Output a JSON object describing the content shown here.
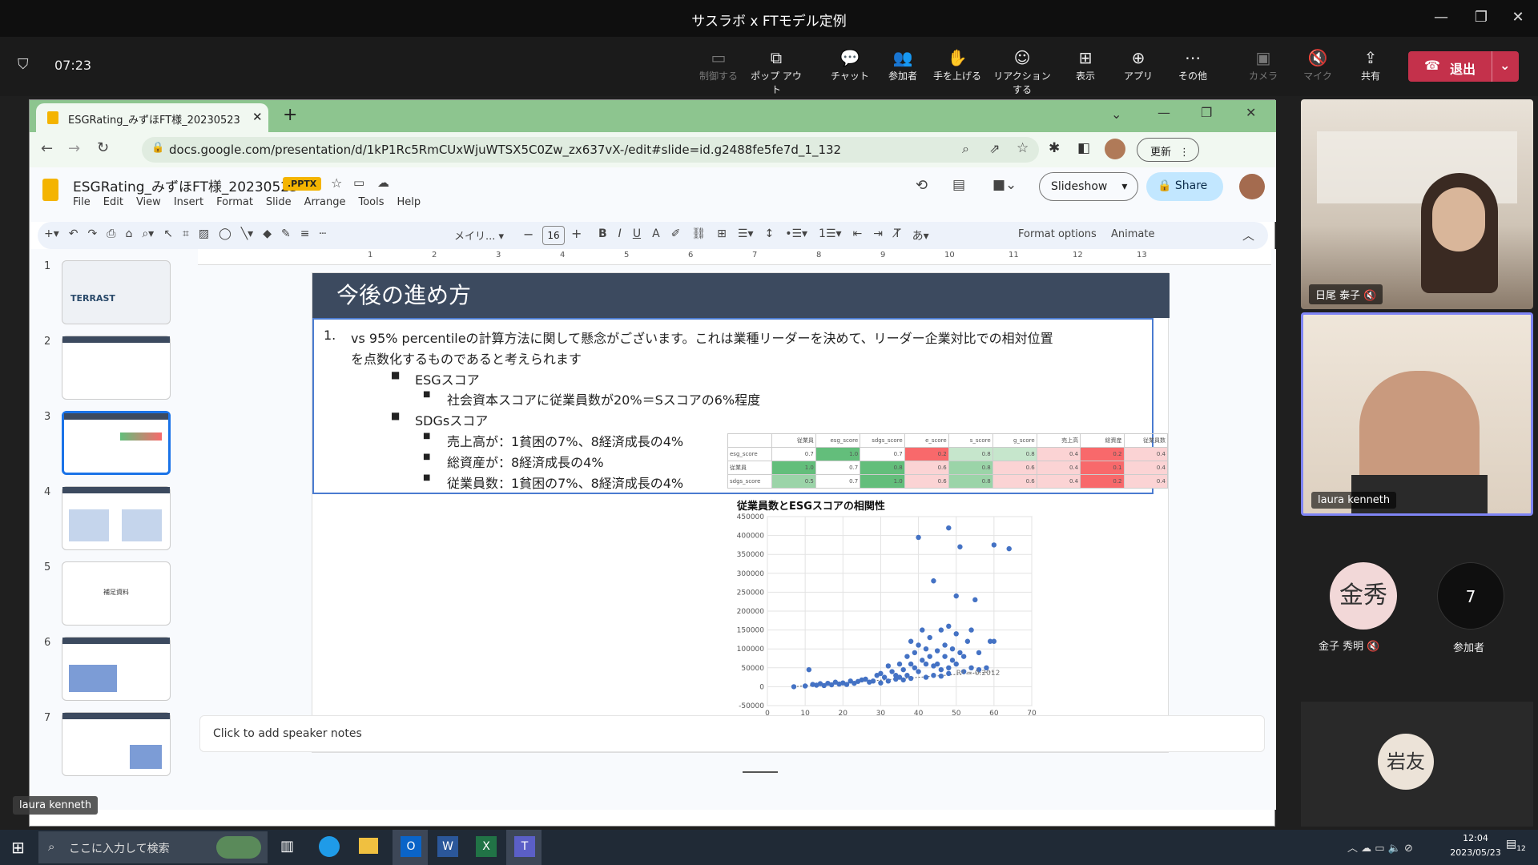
{
  "teams": {
    "window_title": "サスラボ x FTモデル定例",
    "meeting_time": "07:23",
    "buttons": {
      "control": "制御する",
      "popout": "ポップ アウト",
      "chat": "チャット",
      "participants": "参加者",
      "raise_hand": "手を上げる",
      "reaction": "リアクションする",
      "view": "表示",
      "apps": "アプリ",
      "more": "その他",
      "camera": "カメラ",
      "mic": "マイク",
      "share": "共有",
      "leave": "退出"
    }
  },
  "browser": {
    "tab_title": "ESGRating_みずほFT様_20230523",
    "url": "docs.google.com/presentation/d/1kP1Rc5RmCUxWjuWTSX5C0Zw_zx637vX-/edit#slide=id.g2488fe5fe7d_1_132",
    "update_button": "更新"
  },
  "slides": {
    "doc_title": "ESGRating_みずほFT様_20230523",
    "badge": ".PPTX",
    "menu": [
      "File",
      "Edit",
      "View",
      "Insert",
      "Format",
      "Slide",
      "Arrange",
      "Tools",
      "Help"
    ],
    "slideshow_button": "Slideshow",
    "share_button": "Share",
    "toolbar": {
      "font": "メイリ...",
      "font_size": "16",
      "format_options": "Format options",
      "animate": "Animate"
    },
    "ruler": [
      "1",
      "2",
      "3",
      "4",
      "5",
      "6",
      "7",
      "8",
      "9",
      "10",
      "11",
      "12",
      "13"
    ],
    "thumbnails": [
      {
        "num": "1",
        "text": "TERRAST"
      },
      {
        "num": "2",
        "text": ""
      },
      {
        "num": "3",
        "text": ""
      },
      {
        "num": "4",
        "text": ""
      },
      {
        "num": "5",
        "text": "補足資料"
      },
      {
        "num": "6",
        "text": ""
      },
      {
        "num": "7",
        "text": ""
      }
    ],
    "notes_placeholder": "Click to add speaker notes"
  },
  "slide": {
    "title": "今後の進め方",
    "item_number": "1.",
    "line1": "vs 95% percentileの計算方法に関して懸念がございます。これは業種リーダーを決めて、リーダー企業対比での相対位置",
    "line2": "を点数化するものであると考えられます",
    "bullet_esg": "ESGスコア",
    "sub_esg": "社会資本スコアに従業員数が20%＝Sスコアの6%程度",
    "bullet_sdgs": "SDGsスコア",
    "sub_sdgs": [
      "売上高が：1貧困の7%、8経済成長の4%",
      "総資産が：8経済成長の4%",
      "従業員数：1貧困の7%、8経済成長の4%"
    ],
    "table": {
      "headers": [
        "",
        "従業員",
        "esg_score",
        "sdgs_score",
        "e_score",
        "s_score",
        "g_score",
        "売上高",
        "総資産",
        "従業員数"
      ],
      "rows": [
        {
          "label": "esg_score",
          "values": [
            "0.7",
            "1.0",
            "0.7",
            "0.2",
            "0.8",
            "0.8",
            "0.4",
            "0.2",
            "0.4"
          ]
        },
        {
          "label": "従業員",
          "values": [
            "1.0",
            "0.7",
            "0.8",
            "0.6",
            "0.8",
            "0.6",
            "0.4",
            "0.1",
            "0.4"
          ]
        },
        {
          "label": "sdgs_score",
          "values": [
            "0.5",
            "0.7",
            "1.0",
            "0.6",
            "0.8",
            "0.6",
            "0.4",
            "0.2",
            "0.4"
          ]
        }
      ],
      "colors": [
        "#ffffff",
        "#63be7b",
        "#9bd4a8",
        "#f8696b",
        "#fbd3d4",
        "#c6e6cc"
      ]
    }
  },
  "chart_data": {
    "type": "scatter",
    "title": "従業員数とESGスコアの相関性",
    "xlim": [
      0,
      70
    ],
    "ylim": [
      -50000,
      450000
    ],
    "x_ticks": [
      "0",
      "10",
      "20",
      "30",
      "40",
      "50",
      "60",
      "70"
    ],
    "y_ticks": [
      "450000",
      "400000",
      "350000",
      "300000",
      "250000",
      "200000",
      "150000",
      "100000",
      "50000",
      "0",
      "-50000"
    ],
    "annotation": "R² = 0.2012",
    "series_color": "#4472c4",
    "points": [
      [
        7,
        0
      ],
      [
        10,
        2000
      ],
      [
        11,
        45000
      ],
      [
        12,
        6000
      ],
      [
        14,
        8000
      ],
      [
        16,
        9000
      ],
      [
        18,
        12000
      ],
      [
        20,
        10000
      ],
      [
        22,
        15000
      ],
      [
        24,
        14000
      ],
      [
        25,
        18000
      ],
      [
        26,
        20000
      ],
      [
        28,
        15000
      ],
      [
        29,
        30000
      ],
      [
        30,
        35000
      ],
      [
        31,
        25000
      ],
      [
        32,
        55000
      ],
      [
        33,
        40000
      ],
      [
        34,
        30000
      ],
      [
        35,
        60000
      ],
      [
        35,
        25000
      ],
      [
        36,
        45000
      ],
      [
        37,
        80000
      ],
      [
        37,
        30000
      ],
      [
        38,
        60000
      ],
      [
        38,
        120000
      ],
      [
        39,
        50000
      ],
      [
        39,
        90000
      ],
      [
        40,
        110000
      ],
      [
        40,
        40000
      ],
      [
        40,
        395000
      ],
      [
        41,
        70000
      ],
      [
        41,
        150000
      ],
      [
        42,
        60000
      ],
      [
        42,
        100000
      ],
      [
        43,
        80000
      ],
      [
        43,
        130000
      ],
      [
        44,
        280000
      ],
      [
        44,
        55000
      ],
      [
        45,
        95000
      ],
      [
        45,
        60000
      ],
      [
        46,
        150000
      ],
      [
        46,
        45000
      ],
      [
        47,
        110000
      ],
      [
        47,
        80000
      ],
      [
        48,
        420000
      ],
      [
        48,
        160000
      ],
      [
        48,
        50000
      ],
      [
        49,
        70000
      ],
      [
        49,
        100000
      ],
      [
        50,
        140000
      ],
      [
        50,
        240000
      ],
      [
        50,
        60000
      ],
      [
        51,
        90000
      ],
      [
        51,
        370000
      ],
      [
        52,
        80000
      ],
      [
        53,
        120000
      ],
      [
        54,
        150000
      ],
      [
        54,
        50000
      ],
      [
        55,
        230000
      ],
      [
        56,
        90000
      ],
      [
        58,
        50000
      ],
      [
        59,
        120000
      ],
      [
        60,
        120000
      ],
      [
        60,
        375000
      ],
      [
        64,
        365000
      ],
      [
        13,
        4000
      ],
      [
        15,
        3000
      ],
      [
        17,
        5000
      ],
      [
        19,
        7000
      ],
      [
        21,
        6000
      ],
      [
        23,
        9000
      ],
      [
        27,
        12000
      ],
      [
        30,
        10000
      ],
      [
        32,
        15000
      ],
      [
        34,
        20000
      ],
      [
        36,
        18000
      ],
      [
        38,
        22000
      ],
      [
        42,
        25000
      ],
      [
        44,
        30000
      ],
      [
        46,
        28000
      ],
      [
        48,
        35000
      ],
      [
        52,
        40000
      ],
      [
        56,
        45000
      ]
    ]
  },
  "participants": {
    "video1": "日尾 泰子",
    "video2": "laura kenneth",
    "p3_avatar": "金秀",
    "p3_name": "金子 秀明",
    "count": "7",
    "count_label": "参加者",
    "p4_avatar": "岩友",
    "caption_name": "laura kenneth"
  },
  "taskbar": {
    "search_placeholder": "ここに入力して検索",
    "time": "12:04",
    "date": "2023/05/23",
    "notif": "12"
  }
}
